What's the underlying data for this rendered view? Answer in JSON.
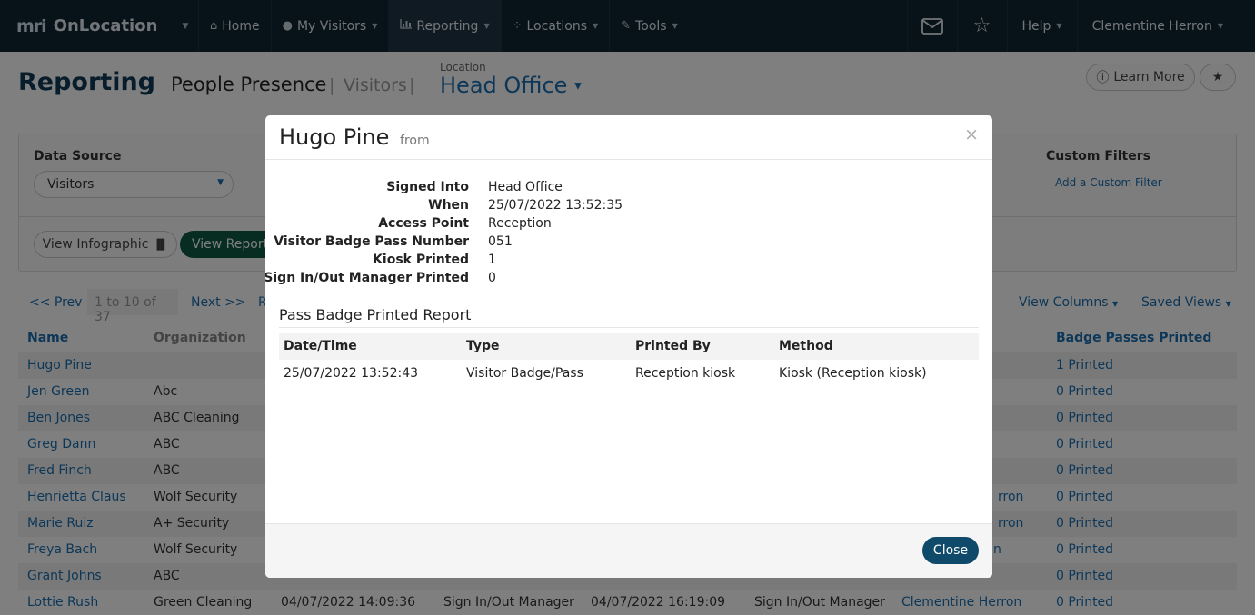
{
  "nav": {
    "brand_logo": "mri",
    "brand_name": "OnLocation",
    "items": [
      {
        "label": "Home",
        "icon": "home-icon"
      },
      {
        "label": "My Visitors",
        "icon": "user-icon"
      },
      {
        "label": "Reporting",
        "icon": "chart-icon"
      },
      {
        "label": "Locations",
        "icon": "locations-icon"
      },
      {
        "label": "Tools",
        "icon": "wrench-icon"
      }
    ],
    "help_label": "Help",
    "user_name": "Clementine Herron"
  },
  "header": {
    "title": "Reporting",
    "subtitle": "People Presence",
    "visitors": "Visitors",
    "location_label": "Location",
    "location": "Head Office",
    "learn_more": "Learn More"
  },
  "filters": {
    "data_source_label": "Data Source",
    "data_source_value": "Visitors",
    "custom_filters_label": "Custom Filters",
    "add_filter": "Add a Custom Filter",
    "view_infographic": "View Infographic",
    "view_report": "View Report"
  },
  "pager": {
    "prev": "<< Prev",
    "range": "1 to 10 of 37",
    "next": "Next >>",
    "partial_r": "R",
    "view_columns": "View Columns",
    "saved_views": "Saved Views"
  },
  "table": {
    "columns": [
      "Name",
      "Organization",
      "Badge Passes Printed"
    ],
    "rows": [
      {
        "name": "Hugo Pine",
        "org": "",
        "visible": [],
        "badge": "1 Printed"
      },
      {
        "name": "Jen Green",
        "org": "Abc",
        "visible": [],
        "badge": "0 Printed"
      },
      {
        "name": "Ben Jones",
        "org": "ABC Cleaning",
        "visible": [],
        "badge": "0 Printed"
      },
      {
        "name": "Greg Dann",
        "org": "ABC",
        "visible": [],
        "badge": "0 Printed"
      },
      {
        "name": "Fred Finch",
        "org": "ABC",
        "visible": [],
        "badge": "0 Printed"
      },
      {
        "name": "Henrietta Claus",
        "org": "Wolf Security",
        "visible": [
          "rron"
        ],
        "badge": "0 Printed"
      },
      {
        "name": "Marie Ruiz",
        "org": "A+ Security",
        "visible": [
          "rron"
        ],
        "badge": "0 Printed"
      },
      {
        "name": "Freya Bach",
        "org": "Wolf Security",
        "visible": [
          "n"
        ],
        "badge": "0 Printed"
      },
      {
        "name": "Grant Johns",
        "org": "ABC",
        "visible": [],
        "badge": "0 Printed"
      },
      {
        "name": "Lottie Rush",
        "org": "Green Cleaning",
        "visible": [
          "04/07/2022 14:09:36",
          "Sign In/Out Manager",
          "04/07/2022 16:19:09",
          "Sign In/Out Manager",
          "Clementine Herron"
        ],
        "badge": "0 Printed"
      }
    ]
  },
  "modal": {
    "name": "Hugo Pine",
    "from": "from",
    "close_x": "×",
    "details": [
      {
        "label": "Signed Into",
        "value": "Head Office"
      },
      {
        "label": "When",
        "value": "25/07/2022 13:52:35"
      },
      {
        "label": "Access Point",
        "value": "Reception"
      },
      {
        "label": "Visitor Badge Pass Number",
        "value": "051"
      },
      {
        "label": "Kiosk Printed",
        "value": "1"
      },
      {
        "label": "Sign In/Out Manager Printed",
        "value": "0"
      }
    ],
    "section_title": "Pass Badge Printed Report",
    "report_columns": [
      "Date/Time",
      "Type",
      "Printed By",
      "Method"
    ],
    "report_rows": [
      [
        "25/07/2022 13:52:43",
        "Visitor Badge/Pass",
        "Reception kiosk",
        "Kiosk (Reception kiosk)"
      ]
    ],
    "close_button": "Close"
  },
  "colors": {
    "navbar": "#0f2433",
    "title": "#0f3a57",
    "link": "#1a6fb0",
    "view_report": "#0f5b45",
    "close_button": "#0f4a6a"
  }
}
